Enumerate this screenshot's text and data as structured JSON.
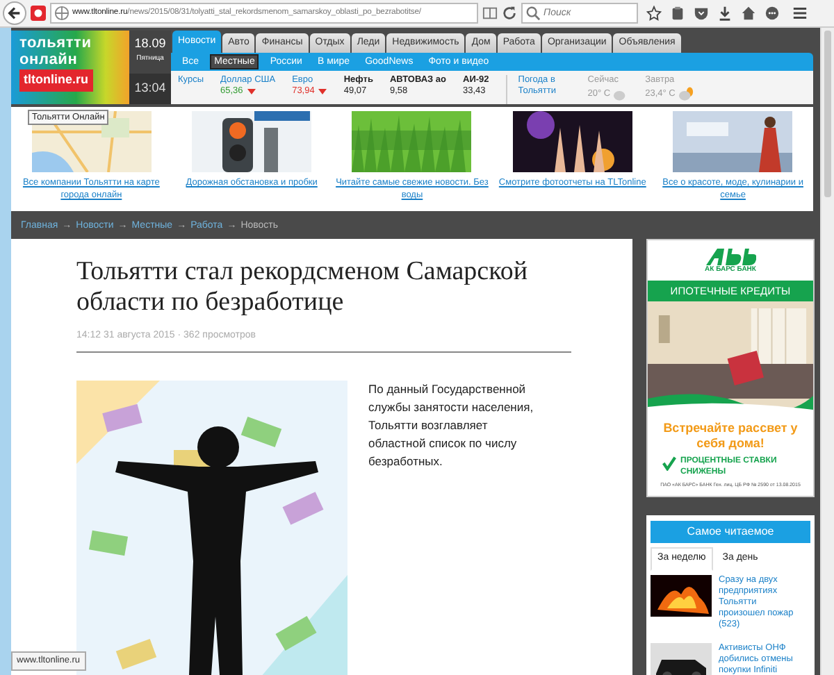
{
  "browser": {
    "url_host": "www.tltonline.ru",
    "url_path": "/news/2015/08/31/tolyatti_stal_rekordsmenom_samarskoy_oblasti_po_bezrabotitse/",
    "search_placeholder": "Поиск"
  },
  "logo": {
    "lines": [
      "тольятти",
      "онлайн"
    ],
    "domain": "tltonline.ru"
  },
  "date": {
    "date": "18.09",
    "weekday": "Пятница",
    "time": "13:04"
  },
  "tabs": [
    {
      "label": "Новости",
      "selected": true
    },
    {
      "label": "Авто",
      "selected": false
    },
    {
      "label": "Финансы",
      "selected": false
    },
    {
      "label": "Отдых",
      "selected": false
    },
    {
      "label": "Леди",
      "selected": false
    },
    {
      "label": "Недвижимость",
      "selected": false
    },
    {
      "label": "Дом",
      "selected": false
    },
    {
      "label": "Работа",
      "selected": false
    },
    {
      "label": "Организации",
      "selected": false
    },
    {
      "label": "Объявления",
      "selected": false
    }
  ],
  "subnav": [
    {
      "label": "Все",
      "selected": false
    },
    {
      "label": "Местные",
      "selected": true
    },
    {
      "label": "России",
      "selected": false
    },
    {
      "label": "В мире",
      "selected": false
    },
    {
      "label": "GoodNews",
      "selected": false
    },
    {
      "label": "Фото и видео",
      "selected": false
    }
  ],
  "rates": {
    "label": "Курсы",
    "items": [
      {
        "kind": "currency",
        "name": "Доллар США",
        "value": "65,36",
        "color": "#2e9a2e",
        "down": true
      },
      {
        "kind": "currency",
        "name": "Евро",
        "value": "73,94",
        "color": "#e0302a",
        "down": true
      },
      {
        "kind": "commodity",
        "name": "Нефть",
        "value": "49,07",
        "down": false
      },
      {
        "kind": "commodity",
        "name": "АВТОВАЗ ао",
        "value": "9,58",
        "down": false
      },
      {
        "kind": "commodity",
        "name": "АИ-92",
        "value": "33,43",
        "down": false
      }
    ]
  },
  "weather": {
    "label": "Погода в Тольятти",
    "items": [
      {
        "name": "Сейчас",
        "value": "20° С"
      },
      {
        "name": "Завтра",
        "value": "23,4° С"
      }
    ]
  },
  "tooltip": "Тольятти Онлайн",
  "promos": [
    {
      "caption": "Все компании Тольятти на карте города онлайн"
    },
    {
      "caption": "Дорожная обстановка и пробки"
    },
    {
      "caption": "Читайте самые свежие новости. Без воды"
    },
    {
      "caption": "Смотрите фотоотчеты на TLTonline"
    },
    {
      "caption": "Все о красоте, моде, кулинарии и семье"
    }
  ],
  "breadcrumb": {
    "separator": "→",
    "items": [
      {
        "label": "Главная",
        "link": true
      },
      {
        "label": "Новости",
        "link": true
      },
      {
        "label": "Местные",
        "link": true
      },
      {
        "label": "Работа",
        "link": true
      },
      {
        "label": "Новость",
        "link": false
      }
    ]
  },
  "article": {
    "title": "Тольятти стал рекордсменом Самарской области по безработице",
    "meta": "14:12 31 августа 2015 · 362 просмотров",
    "lead": "По данный Государственной службы занятости населения, Тольятти возглавляет областной список по числу безработных."
  },
  "ad": {
    "bank": "АК БАРС БАНК",
    "banner": "ИПОТЕЧНЫЕ КРЕДИТЫ",
    "slogan": "Встречайте рассвет у себя дома!",
    "offer": "ПРОЦЕНТНЫЕ СТАВКИ СНИЖЕНЫ",
    "legal": "ПАО «АК БАРС» БАНК Ген. лиц. ЦБ РФ № 2590 от 13.08.2015"
  },
  "popular": {
    "title": "Самое читаемое",
    "tabs": [
      {
        "label": "За неделю",
        "selected": true
      },
      {
        "label": "За день",
        "selected": false
      }
    ],
    "items": [
      {
        "text": "Сразу на двух предприятиях Тольятти произошел пожар (523)"
      },
      {
        "text": "Активисты ОНФ добились отмены покупки Infiniti"
      }
    ]
  },
  "status_url": "www.tltonline.ru"
}
